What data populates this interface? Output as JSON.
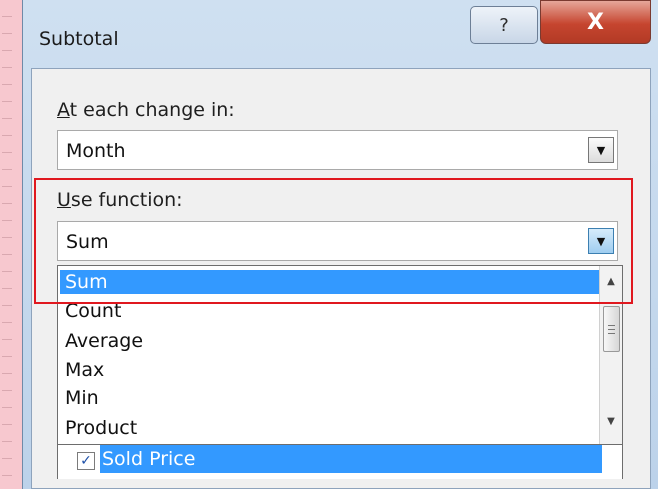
{
  "dialog": {
    "title": "Subtotal",
    "help_label": "?",
    "close_label": "X"
  },
  "change_in": {
    "label_mnemonic": "A",
    "label_rest": "t each change in:",
    "value": "Month"
  },
  "use_function": {
    "label_mnemonic": "U",
    "label_rest": "se function:",
    "value": "Sum",
    "options": [
      "Sum",
      "Count",
      "Average",
      "Max",
      "Min",
      "Product"
    ],
    "selected_option": "Sum"
  },
  "subtotal_fields": {
    "visible_item": "Sold Price",
    "checked": true
  },
  "colors": {
    "highlight": "#3399ff",
    "annotation": "#e0181f"
  }
}
